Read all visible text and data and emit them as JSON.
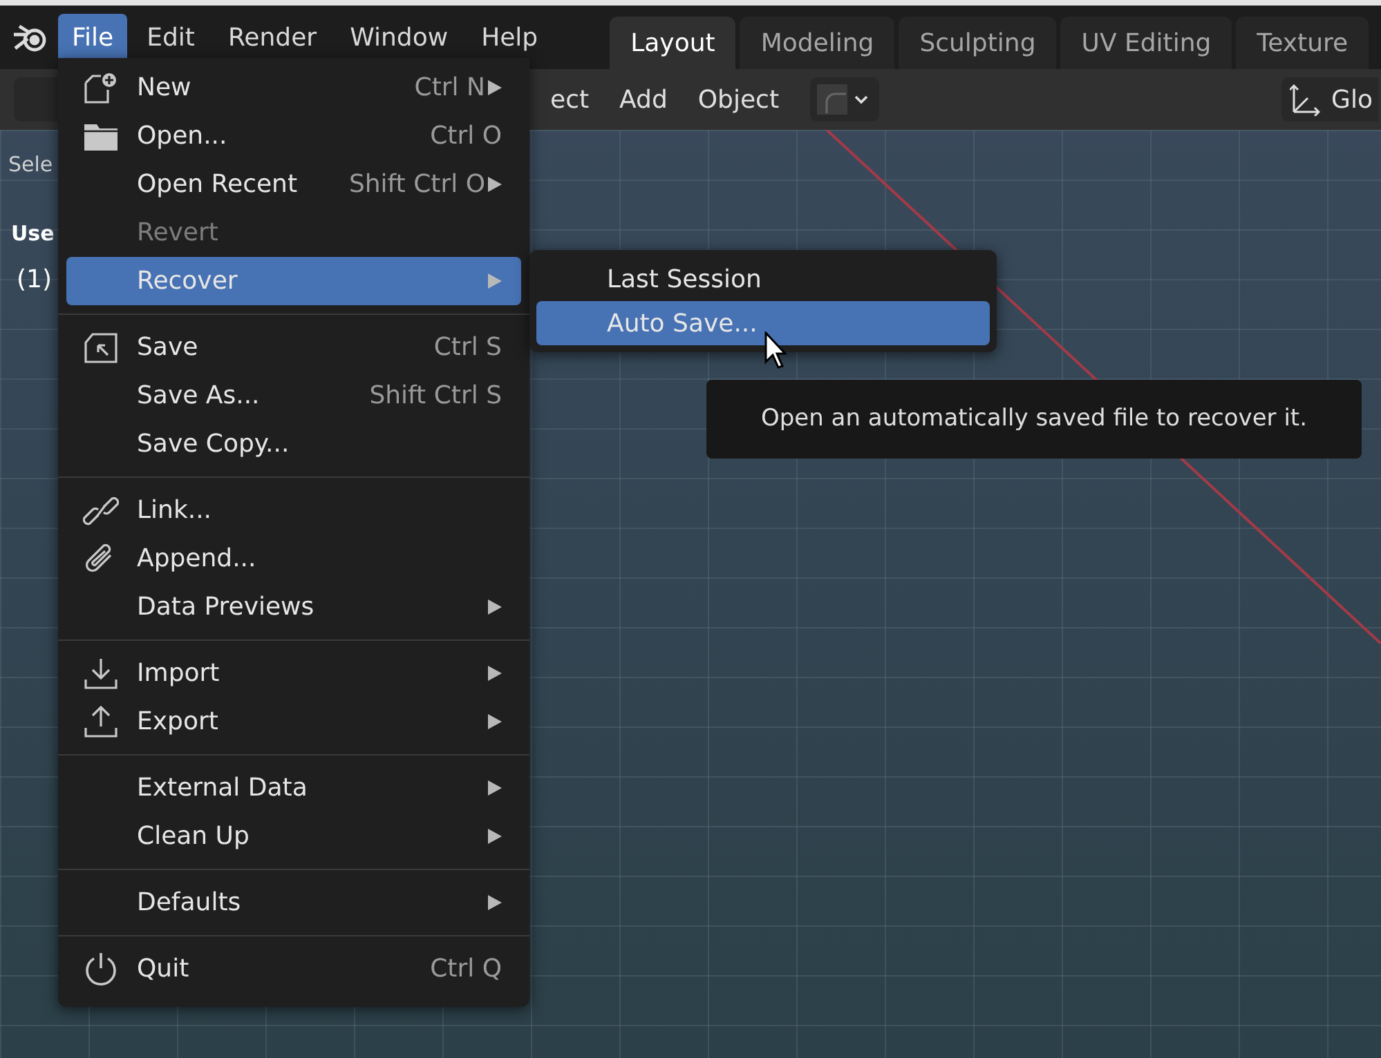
{
  "menu_bar": [
    {
      "label": "File",
      "selected": true
    },
    {
      "label": "Edit",
      "selected": false
    },
    {
      "label": "Render",
      "selected": false
    },
    {
      "label": "Window",
      "selected": false
    },
    {
      "label": "Help",
      "selected": false
    }
  ],
  "workspace_tabs": [
    {
      "label": "Layout",
      "selected": true
    },
    {
      "label": "Modeling",
      "selected": false
    },
    {
      "label": "Sculpting",
      "selected": false
    },
    {
      "label": "UV Editing",
      "selected": false
    },
    {
      "label": "Texture",
      "selected": false
    }
  ],
  "toolbar": {
    "items": [
      "ect",
      "Add",
      "Object"
    ],
    "orientation_label": "Glo"
  },
  "viewport": {
    "tool_label": "Sele",
    "view_label": "Use",
    "collection_label": "(1)"
  },
  "file_menu": {
    "sections": [
      {
        "items": [
          {
            "label": "New",
            "shortcut": "Ctrl N",
            "submenu": true,
            "disabled": false,
            "selected": false
          },
          {
            "label": "Open...",
            "shortcut": "Ctrl O",
            "submenu": false,
            "disabled": false,
            "selected": false
          },
          {
            "label": "Open Recent",
            "shortcut": "Shift Ctrl O",
            "submenu": true,
            "disabled": false,
            "selected": false
          },
          {
            "label": "Revert",
            "submenu": false,
            "disabled": true,
            "selected": false
          },
          {
            "label": "Recover",
            "submenu": true,
            "disabled": false,
            "selected": true
          }
        ]
      },
      {
        "items": [
          {
            "label": "Save",
            "shortcut": "Ctrl S",
            "submenu": false,
            "disabled": false,
            "selected": false
          },
          {
            "label": "Save As...",
            "shortcut": "Shift Ctrl S",
            "submenu": false,
            "disabled": false,
            "selected": false
          },
          {
            "label": "Save Copy...",
            "submenu": false,
            "disabled": false,
            "selected": false
          }
        ]
      },
      {
        "items": [
          {
            "label": "Link...",
            "submenu": false,
            "disabled": false,
            "selected": false
          },
          {
            "label": "Append...",
            "submenu": false,
            "disabled": false,
            "selected": false
          },
          {
            "label": "Data Previews",
            "submenu": true,
            "disabled": false,
            "selected": false
          }
        ]
      },
      {
        "items": [
          {
            "label": "Import",
            "submenu": true,
            "disabled": false,
            "selected": false
          },
          {
            "label": "Export",
            "submenu": true,
            "disabled": false,
            "selected": false
          }
        ]
      },
      {
        "items": [
          {
            "label": "External Data",
            "submenu": true,
            "disabled": false,
            "selected": false
          },
          {
            "label": "Clean Up",
            "submenu": true,
            "disabled": false,
            "selected": false
          }
        ]
      },
      {
        "items": [
          {
            "label": "Defaults",
            "submenu": true,
            "disabled": false,
            "selected": false
          }
        ]
      },
      {
        "items": [
          {
            "label": "Quit",
            "shortcut": "Ctrl Q",
            "submenu": false,
            "disabled": false,
            "selected": false
          }
        ]
      }
    ]
  },
  "recover_submenu": {
    "items": [
      {
        "label": "Last Session",
        "selected": false
      },
      {
        "label": "Auto Save...",
        "selected": true
      }
    ]
  },
  "tooltip": {
    "text": "Open an automatically saved file to recover it."
  }
}
